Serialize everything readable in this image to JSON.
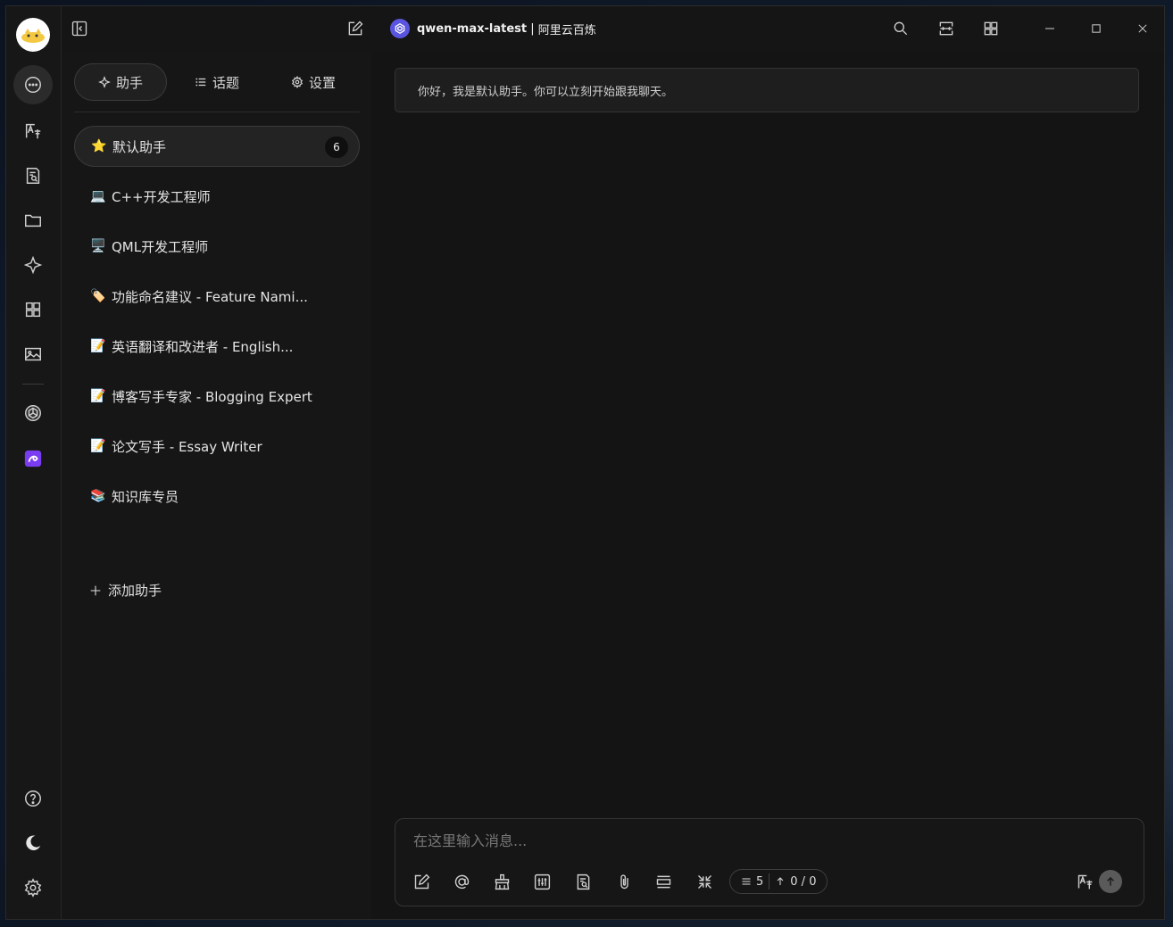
{
  "titlebar": {
    "model_name": "qwen-max-latest",
    "separator": " | ",
    "provider": "阿里云百炼"
  },
  "panel": {
    "tabs": [
      {
        "label": "助手",
        "icon": "sparkle-icon"
      },
      {
        "label": "话题",
        "icon": "list-icon"
      },
      {
        "label": "设置",
        "icon": "gear-icon"
      }
    ],
    "assistants": [
      {
        "emoji": "⭐",
        "name": "默认助手",
        "badge": "6"
      },
      {
        "emoji": "💻",
        "name": "C++开发工程师"
      },
      {
        "emoji": "🖥️",
        "name": "QML开发工程师"
      },
      {
        "emoji": "🏷️",
        "name": "功能命名建议 - Feature Nami..."
      },
      {
        "emoji": "📝",
        "name": "英语翻译和改进者 - English..."
      },
      {
        "emoji": "📝",
        "name": "博客写手专家 - Blogging Expert"
      },
      {
        "emoji": "📝",
        "name": "论文写手 - Essay Writer"
      },
      {
        "emoji": "📚",
        "name": "知识库专员"
      }
    ],
    "add_label": "添加助手"
  },
  "chat": {
    "greeting": "你好，我是默认助手。你可以立刻开始跟我聊天。",
    "input_placeholder": "在这里输入消息...",
    "context_count": "5",
    "token_count": "0 / 0"
  },
  "colors": {
    "accent": "#5a55e0",
    "background": "#141414",
    "panel": "#161616"
  }
}
